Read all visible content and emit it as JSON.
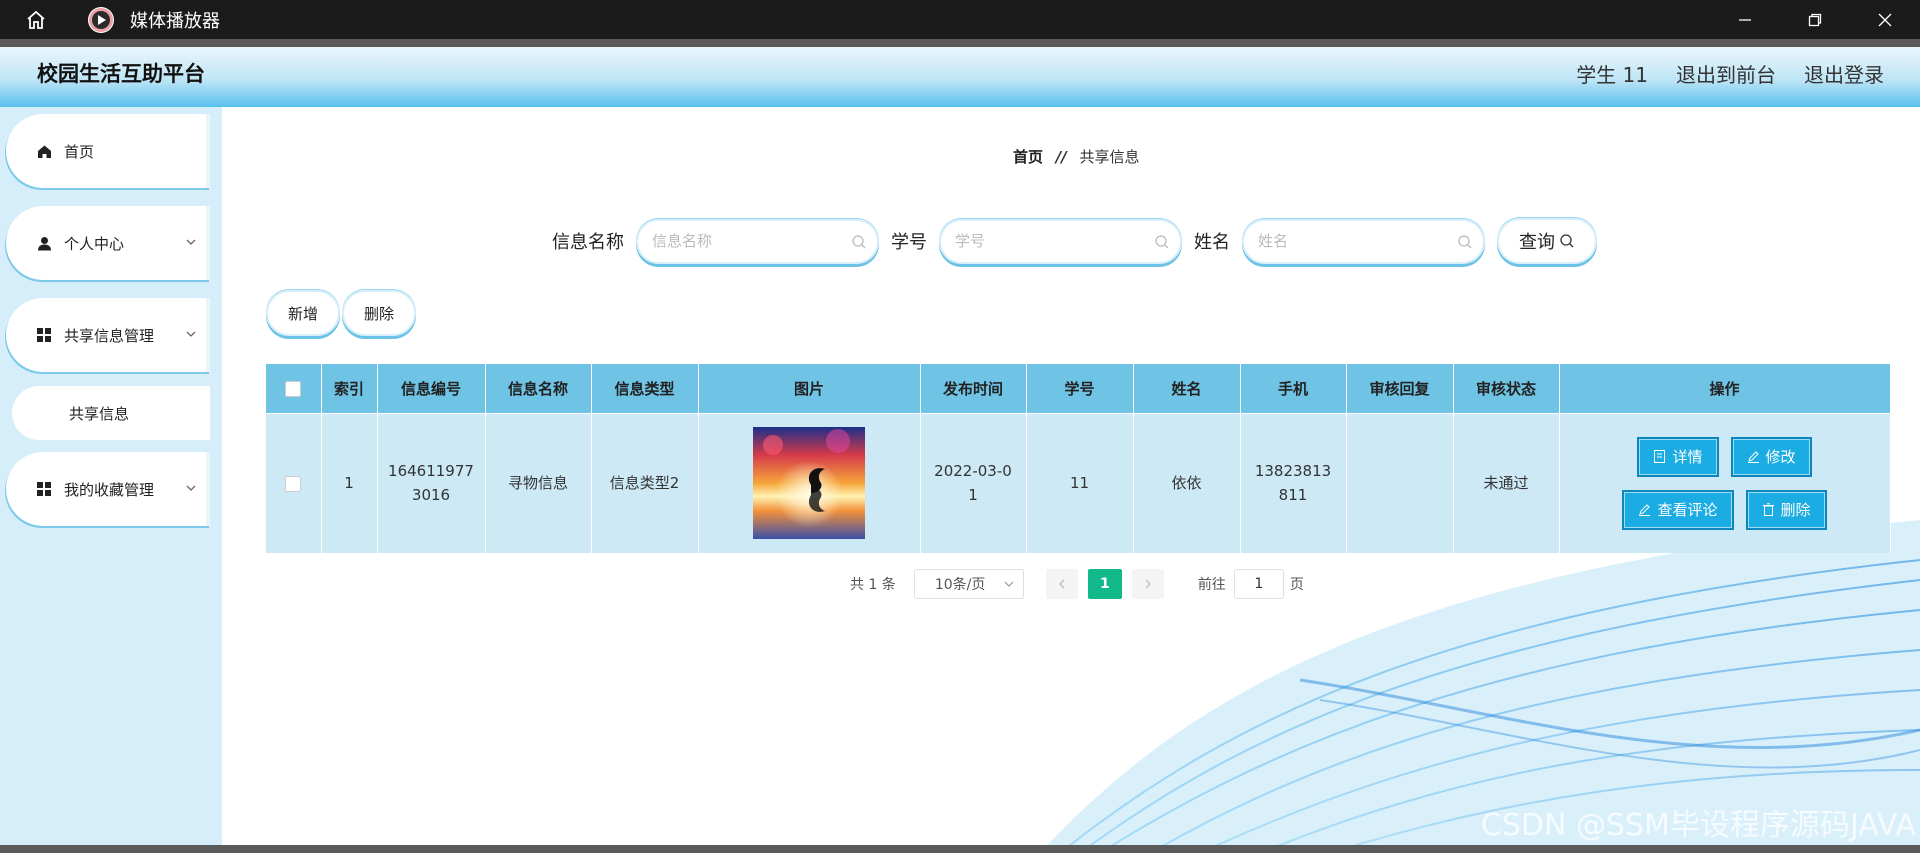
{
  "titlebar": {
    "app_title": "媒体播放器",
    "icons": [
      "home-icon",
      "play-icon",
      "minimize-icon",
      "restore-icon",
      "close-icon"
    ]
  },
  "header": {
    "brand": "校园生活互助平台",
    "user": "学生 11",
    "to_front": "退出到前台",
    "logout": "退出登录"
  },
  "sidebar": {
    "items": [
      {
        "label": "首页",
        "icon": "home-icon"
      },
      {
        "label": "个人中心",
        "icon": "user-icon"
      },
      {
        "label": "共享信息管理",
        "icon": "grid-icon"
      },
      {
        "label": "共享信息"
      },
      {
        "label": "我的收藏管理",
        "icon": "grid-icon"
      }
    ]
  },
  "breadcrumb": {
    "home": "首页",
    "sep": "//",
    "current": "共享信息"
  },
  "search": {
    "name_label": "信息名称",
    "name_placeholder": "信息名称",
    "no_label": "学号",
    "no_placeholder": "学号",
    "person_label": "姓名",
    "person_placeholder": "姓名",
    "query_label": "查询"
  },
  "actions": {
    "add": "新增",
    "delete": "删除"
  },
  "table": {
    "headers": [
      "索引",
      "信息编号",
      "信息名称",
      "信息类型",
      "图片",
      "发布时间",
      "学号",
      "姓名",
      "手机",
      "审核回复",
      "审核状态",
      "操作"
    ],
    "rows": [
      {
        "index": "1",
        "code": "1646119773016",
        "name": "寻物信息",
        "type": "信息类型2",
        "date": "2022-03-01",
        "student_no": "11",
        "person": "依依",
        "phone": "13823813811",
        "reply": "",
        "status": "未通过"
      }
    ],
    "ops": {
      "detail": "详情",
      "edit": "修改",
      "comments": "查看评论",
      "delete": "删除"
    }
  },
  "pagination": {
    "total": "共 1 条",
    "page_size": "10条/页",
    "current_page": "1",
    "goto_label": "前往",
    "goto_value": "1",
    "page_unit": "页"
  },
  "watermark": "CSDN @SSM毕设程序源码JAVA",
  "colors": {
    "accent": "#6fc4e5",
    "button": "#1bace3",
    "active_page": "#12b98a",
    "sidebar_bg": "#d6eef9"
  }
}
